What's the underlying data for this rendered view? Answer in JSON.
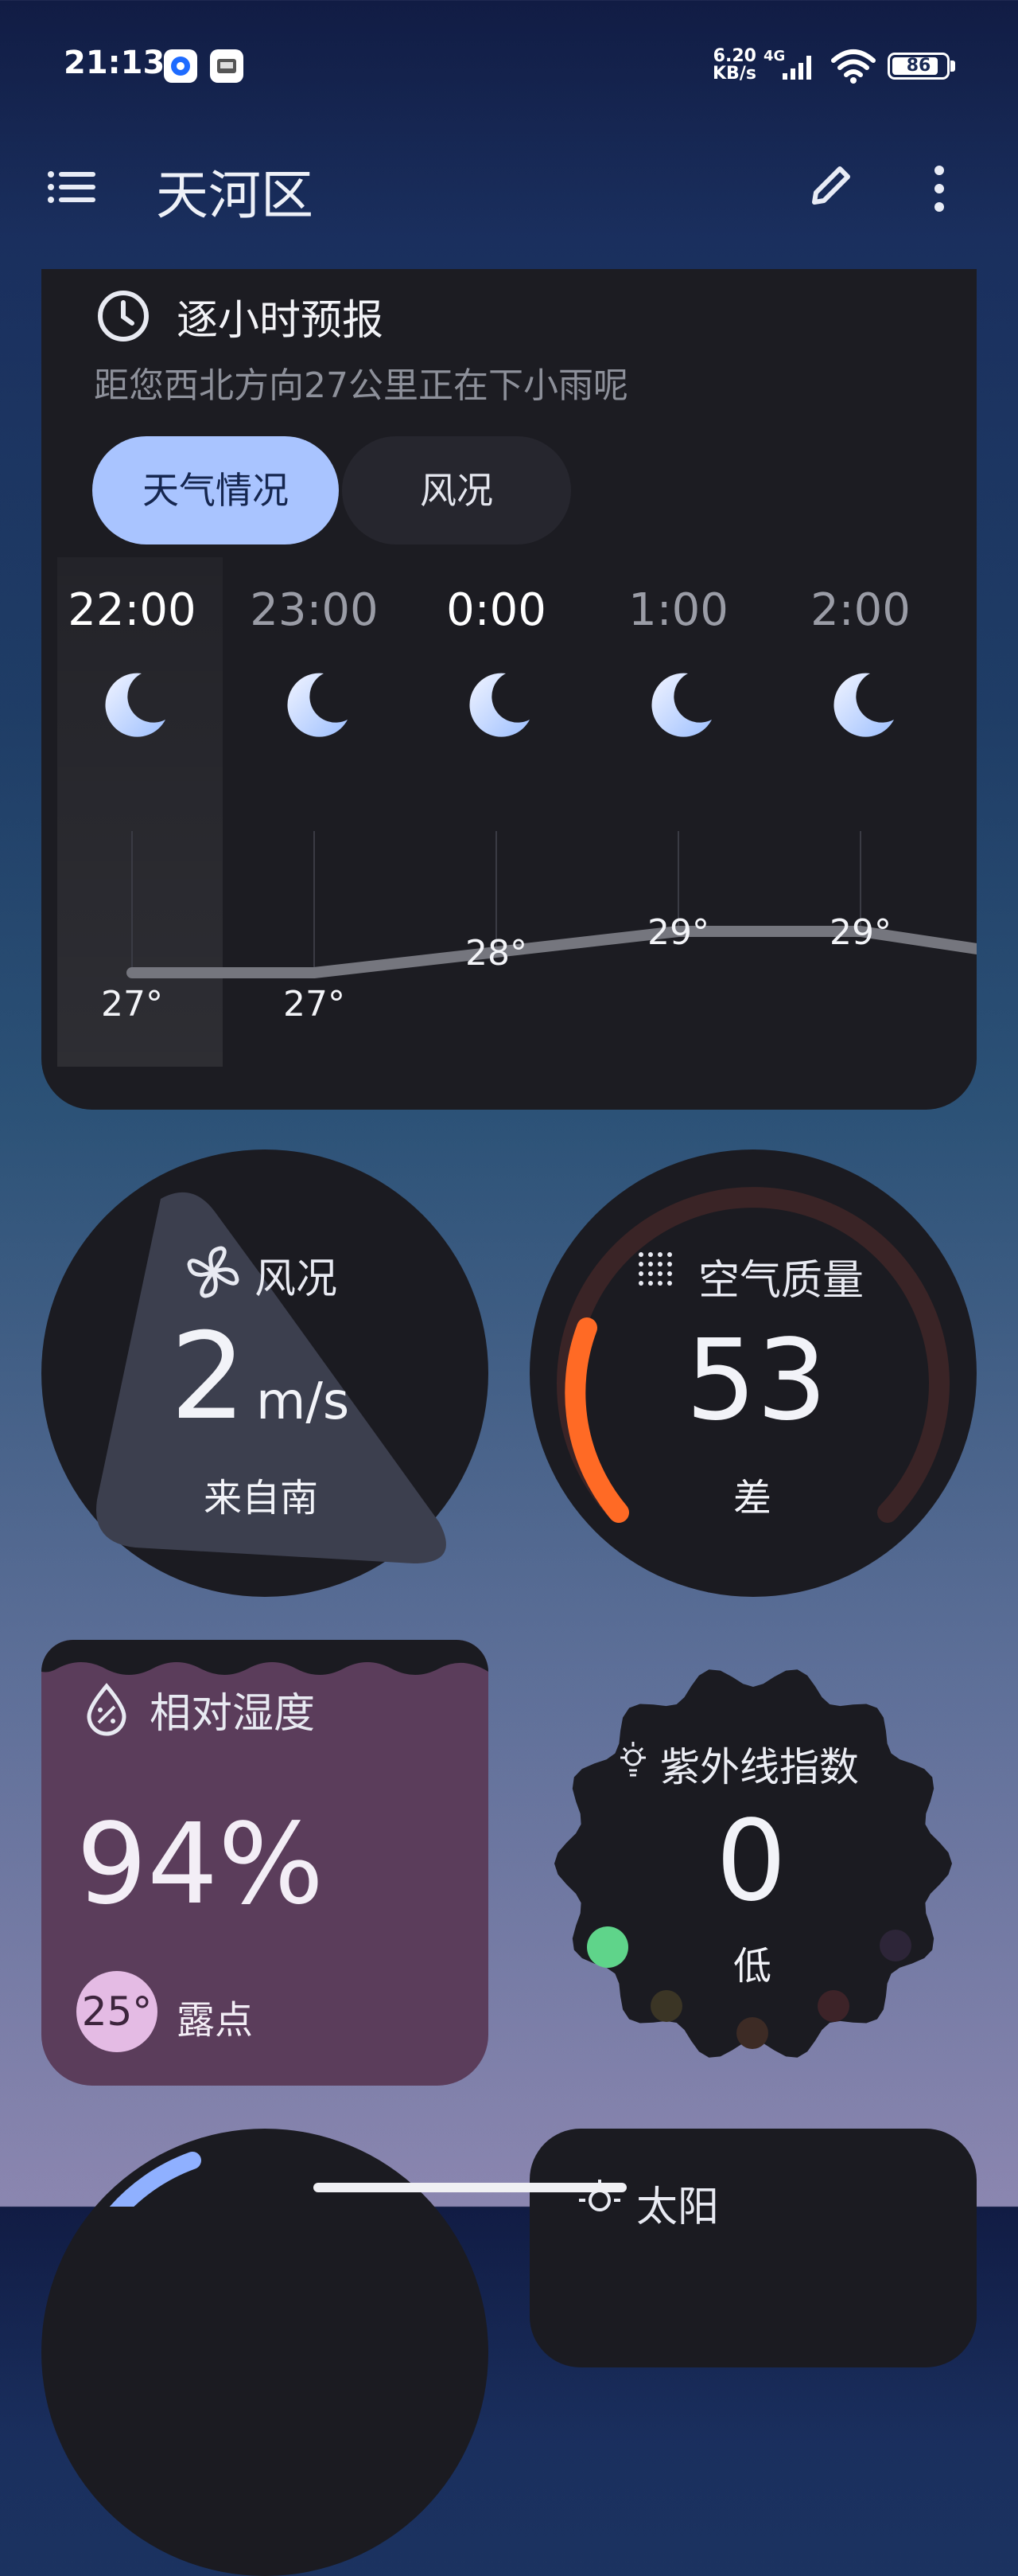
{
  "status_bar": {
    "time": "21:13",
    "net_speed_value": "6.20",
    "net_speed_unit": "KB/s",
    "network": "4G",
    "battery": "86",
    "battery_level": 0.86
  },
  "app_bar": {
    "title": "天河区",
    "menu_icon": "menu-icon",
    "edit_icon": "edit-icon",
    "more_icon": "more-vert-icon"
  },
  "hourly": {
    "title": "逐小时预报",
    "subtitle": "距您西北方向27公里正在下小雨呢",
    "tabs": [
      {
        "label": "天气情况",
        "selected": true
      },
      {
        "label": "风况",
        "selected": false
      }
    ],
    "hours": [
      {
        "time": "22:00",
        "temp": "27°",
        "temp_value": 27,
        "icon": "moon-icon"
      },
      {
        "time": "23:00",
        "temp": "27°",
        "temp_value": 27,
        "icon": "moon-icon"
      },
      {
        "time": "0:00",
        "temp": "28°",
        "temp_value": 28,
        "icon": "moon-icon"
      },
      {
        "time": "1:00",
        "temp": "29°",
        "temp_value": 29,
        "icon": "moon-icon"
      },
      {
        "time": "2:00",
        "temp": "29°",
        "temp_value": 29,
        "icon": "moon-icon"
      }
    ]
  },
  "wind": {
    "label": "风况",
    "speed": "2",
    "unit": "m/s",
    "direction": "来自南"
  },
  "air_quality": {
    "label": "空气质量",
    "value": "53",
    "level": "差",
    "accent": "#ff6a25"
  },
  "humidity": {
    "label": "相对湿度",
    "value": "94%",
    "dew_point_value": "25°",
    "dew_point_label": "露点",
    "fill_level": 0.94
  },
  "uv": {
    "label": "紫外线指数",
    "value": "0",
    "level": "低",
    "active_color": "#5fd48a"
  },
  "sun": {
    "label": "太阳"
  }
}
